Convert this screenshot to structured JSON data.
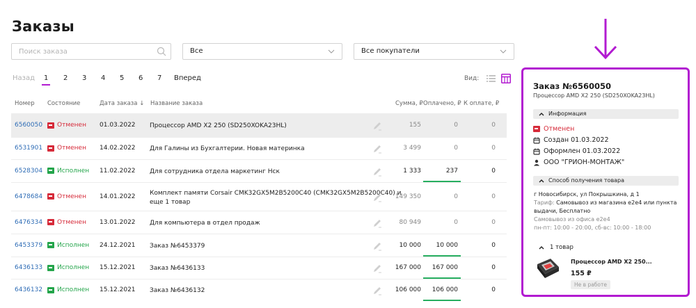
{
  "title": "Заказы",
  "search": {
    "placeholder": "Поиск заказа",
    "icon": "search-icon"
  },
  "filters": {
    "status_value": "Все",
    "buyer_value": "Все покупатели"
  },
  "pagination": {
    "prev_label": "Назад",
    "pages": [
      "1",
      "2",
      "3",
      "4",
      "5",
      "6",
      "7"
    ],
    "active_page": "1",
    "next_label": "Вперед"
  },
  "view": {
    "label": "Вид:"
  },
  "table": {
    "headers": {
      "number": "Номер",
      "state": "Состояние",
      "date": "Дата заказа ↓",
      "name": "Название заказа",
      "sum": "Сумма, ₽",
      "paid": "Оплачено, ₽",
      "due": "К оплате, ₽"
    },
    "rows": [
      {
        "number": "6560050",
        "state": "Отменен",
        "state_type": "cancel",
        "date": "01.03.2022",
        "name": "Процессор AMD X2 250 (SD250XOKA23HL)",
        "sum": "155",
        "paid": "0",
        "due": "0"
      },
      {
        "number": "6531901",
        "state": "Отменен",
        "state_type": "cancel",
        "date": "14.02.2022",
        "name": "Для Галины из Бухгалтерии. Новая материнка",
        "sum": "3 499",
        "paid": "0",
        "due": "0"
      },
      {
        "number": "6528304",
        "state": "Исполнен",
        "state_type": "done",
        "date": "11.02.2022",
        "name": "Для сотрудника отдела маркетинг Нск",
        "sum": "1 333",
        "paid": "237",
        "due": "0"
      },
      {
        "number": "6478684",
        "state": "Отменен",
        "state_type": "cancel",
        "date": "14.01.2022",
        "name": "Комплект памяти Corsair CMK32GX5M2B5200C40 (CMK32GX5M2B5200C40) и",
        "name2": "еще 1 товар",
        "sum": "149 350",
        "paid": "0",
        "due": "0"
      },
      {
        "number": "6476334",
        "state": "Отменен",
        "state_type": "cancel",
        "date": "13.01.2022",
        "name": "Для компьютера в отдел продаж",
        "sum": "80 949",
        "paid": "0",
        "due": "0"
      },
      {
        "number": "6453379",
        "state": "Исполнен",
        "state_type": "done",
        "date": "24.12.2021",
        "name": "Заказ №6453379",
        "sum": "10 000",
        "paid": "10 000",
        "due": "0"
      },
      {
        "number": "6436133",
        "state": "Исполнен",
        "state_type": "done",
        "date": "15.12.2021",
        "name": "Заказ №6436133",
        "sum": "167 000",
        "paid": "167 000",
        "due": "0"
      },
      {
        "number": "6436132",
        "state": "Исполнен",
        "state_type": "done",
        "date": "15.12.2021",
        "name": "Заказ №6436132",
        "sum": "106 000",
        "paid": "106 000",
        "due": "0"
      }
    ]
  },
  "panel": {
    "title": "Заказ №6560050",
    "subtitle": "Процессор AMD X2 250 (SD250XOKA23HL)",
    "info_header": "Информация",
    "status": "Отменен",
    "created": "Создан 01.03.2022",
    "issued": "Оформлен 01.03.2022",
    "company": "ООО \"ГРИОН-МОНТАЖ\"",
    "delivery_header": "Способ получения товара",
    "address": "г Новосибирск, ул Покрышкина, д 1",
    "tariff_label": "Тариф:",
    "tariff": "Самовывоз из магазина e2e4 или пункта",
    "tariff2": "выдачи, Бесплатно",
    "pickup": "Самовывоз из офиса e2e4",
    "hours": "пн-пт: 10:00 - 20:00, сб-вс: 10:00 - 18:00",
    "goods_header": "1 товар",
    "product_name": "Процессор AMD X2 250...",
    "product_price": "155 ₽",
    "product_status": "Не в работе"
  },
  "colors": {
    "accent": "#b21bd1",
    "link": "#2f6db6",
    "cancel": "#d62b3a",
    "done": "#24a54b"
  }
}
